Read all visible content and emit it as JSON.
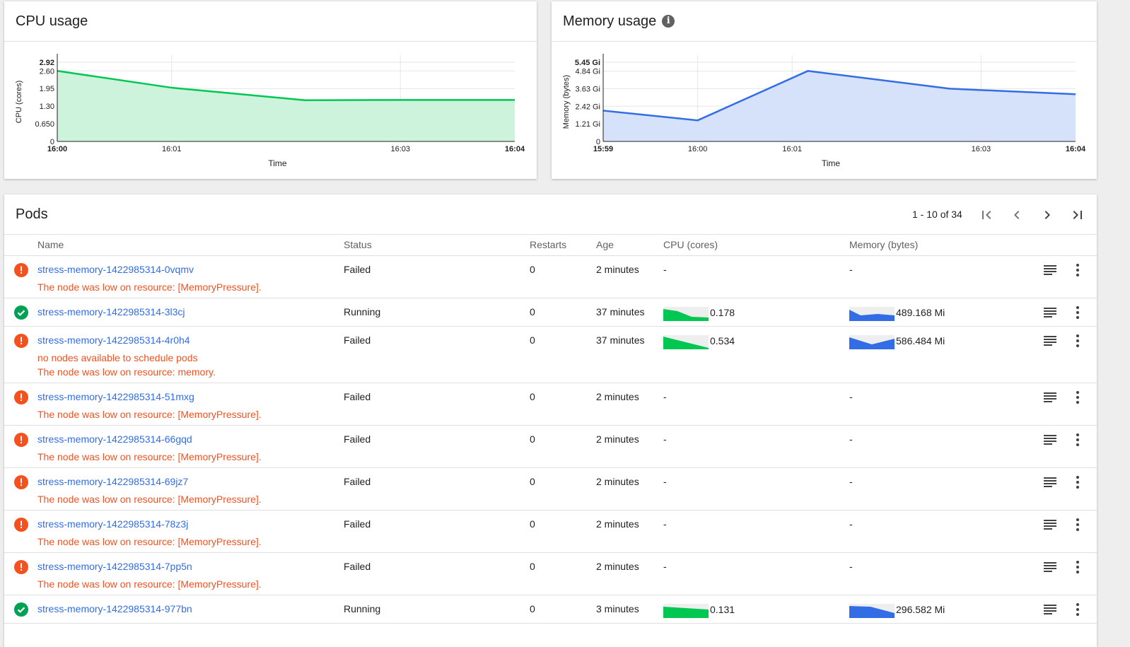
{
  "cpu_card": {
    "title": "CPU usage",
    "chart_data": {
      "type": "area",
      "title": "",
      "xlabel": "Time",
      "ylabel": "CPU (cores)",
      "x_ticks": [
        "16:00",
        "16:01",
        "16:03",
        "16:04"
      ],
      "y_ticks": [
        "2.92",
        "2.60",
        "1.95",
        "1.30",
        "0.650",
        "0"
      ],
      "ylim": [
        0,
        2.92
      ],
      "color": "#00c752",
      "fill": "#cdf3dc",
      "series": [
        {
          "x": [
            "16:00",
            "16:01",
            "16:02:10",
            "16:03",
            "16:04"
          ],
          "values": [
            2.6,
            1.98,
            1.52,
            1.53,
            1.53
          ]
        }
      ]
    }
  },
  "mem_card": {
    "title": "Memory usage",
    "info_icon": "info-icon",
    "chart_data": {
      "type": "area",
      "title": "",
      "xlabel": "Time",
      "ylabel": "Memory (bytes)",
      "x_ticks": [
        "15:59",
        "16:00",
        "16:01",
        "16:03",
        "16:04"
      ],
      "y_ticks": [
        "5.45 Gi",
        "4.84 Gi",
        "3.63 Gi",
        "2.42 Gi",
        "1.21 Gi",
        "0"
      ],
      "ylim": [
        0,
        5.45
      ],
      "color": "#326de6",
      "fill": "#d6e1fa",
      "series": [
        {
          "x": [
            "15:59",
            "16:00",
            "16:01:10",
            "16:02:40",
            "16:04"
          ],
          "values_gi": [
            2.12,
            1.45,
            4.85,
            3.63,
            3.25
          ]
        }
      ]
    }
  },
  "pods": {
    "title": "Pods",
    "pagination": "1 - 10 of 34",
    "columns": [
      "Name",
      "Status",
      "Restarts",
      "Age",
      "CPU (cores)",
      "Memory (bytes)"
    ],
    "rows": [
      {
        "name": "stress-memory-1422985314-0vqmv",
        "status": "Failed",
        "restarts": "0",
        "age": "2 minutes",
        "cpu": "-",
        "memory": "-",
        "messages": [
          "The node was low on resource: [MemoryPressure]."
        ],
        "ok": false
      },
      {
        "name": "stress-memory-1422985314-3l3cj",
        "status": "Running",
        "restarts": "0",
        "age": "37 minutes",
        "cpu": "0.178",
        "memory": "489.168 Mi",
        "messages": [],
        "ok": true
      },
      {
        "name": "stress-memory-1422985314-4r0h4",
        "status": "Failed",
        "restarts": "0",
        "age": "37 minutes",
        "cpu": "0.534",
        "memory": "586.484 Mi",
        "messages": [
          "no nodes available to schedule pods",
          "The node was low on resource: memory."
        ],
        "ok": false
      },
      {
        "name": "stress-memory-1422985314-51mxg",
        "status": "Failed",
        "restarts": "0",
        "age": "2 minutes",
        "cpu": "-",
        "memory": "-",
        "messages": [
          "The node was low on resource: [MemoryPressure]."
        ],
        "ok": false
      },
      {
        "name": "stress-memory-1422985314-66gqd",
        "status": "Failed",
        "restarts": "0",
        "age": "2 minutes",
        "cpu": "-",
        "memory": "-",
        "messages": [
          "The node was low on resource: [MemoryPressure]."
        ],
        "ok": false
      },
      {
        "name": "stress-memory-1422985314-69jz7",
        "status": "Failed",
        "restarts": "0",
        "age": "2 minutes",
        "cpu": "-",
        "memory": "-",
        "messages": [
          "The node was low on resource: [MemoryPressure]."
        ],
        "ok": false
      },
      {
        "name": "stress-memory-1422985314-78z3j",
        "status": "Failed",
        "restarts": "0",
        "age": "2 minutes",
        "cpu": "-",
        "memory": "-",
        "messages": [
          "The node was low on resource: [MemoryPressure]."
        ],
        "ok": false
      },
      {
        "name": "stress-memory-1422985314-7pp5n",
        "status": "Failed",
        "restarts": "0",
        "age": "2 minutes",
        "cpu": "-",
        "memory": "-",
        "messages": [
          "The node was low on resource: [MemoryPressure]."
        ],
        "ok": false
      },
      {
        "name": "stress-memory-1422985314-977bn",
        "status": "Running",
        "restarts": "0",
        "age": "3 minutes",
        "cpu": "0.131",
        "memory": "296.582 Mi",
        "messages": [],
        "ok": true
      }
    ]
  },
  "colors": {
    "link": "#326de6",
    "error": "#f4511e",
    "success": "#00a152",
    "cpu": "#00c752",
    "memory": "#326de6"
  },
  "icons": {
    "failed": "error-icon",
    "running": "check-circle-icon",
    "logs": "logs-icon",
    "menu": "more-vert-icon",
    "first": "first-page-icon",
    "prev": "chevron-left-icon",
    "next": "chevron-right-icon",
    "last": "last-page-icon"
  }
}
